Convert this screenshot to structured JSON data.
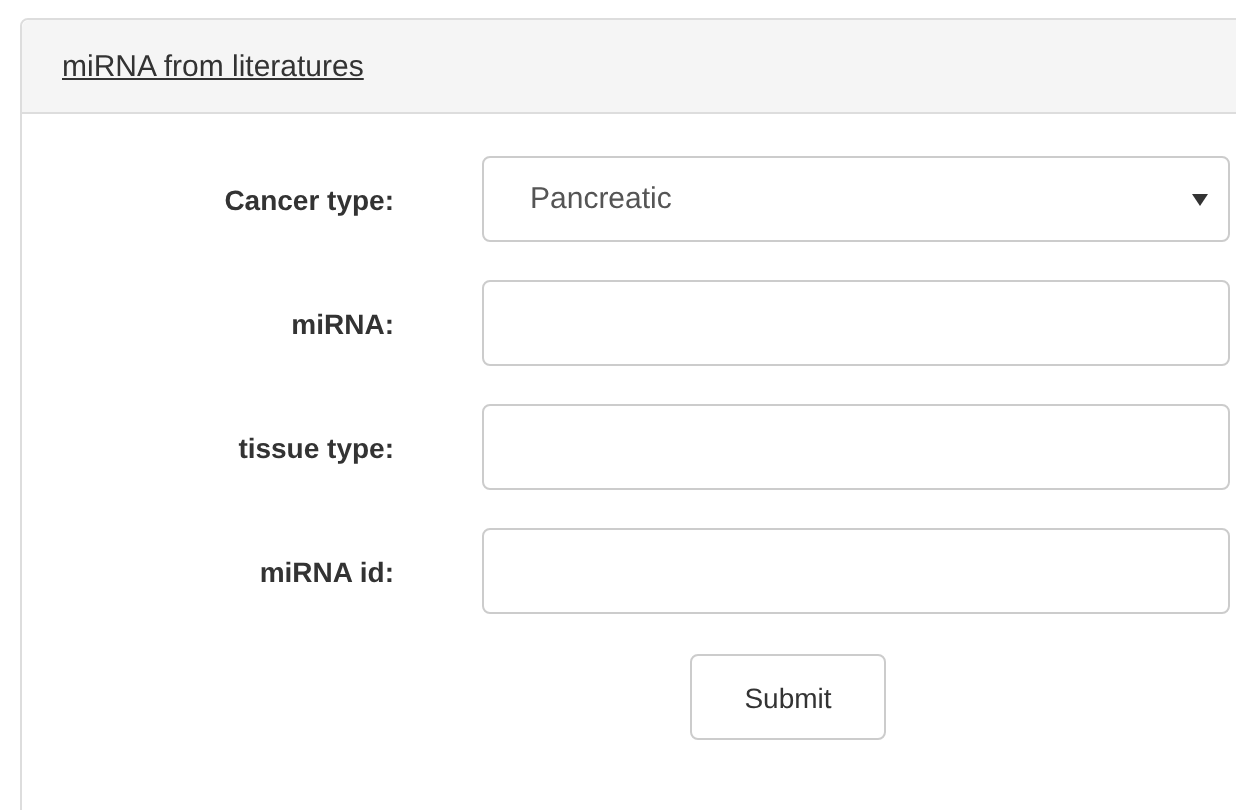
{
  "panel": {
    "title": "miRNA from literatures"
  },
  "fields": [
    {
      "kind": "select",
      "label": "Cancer type:",
      "value": "Pancreatic"
    },
    {
      "kind": "text",
      "label": "miRNA:"
    },
    {
      "kind": "text",
      "label": "tissue type:"
    },
    {
      "kind": "text",
      "label": "miRNA id:"
    }
  ],
  "submit": {
    "label": "Submit"
  }
}
